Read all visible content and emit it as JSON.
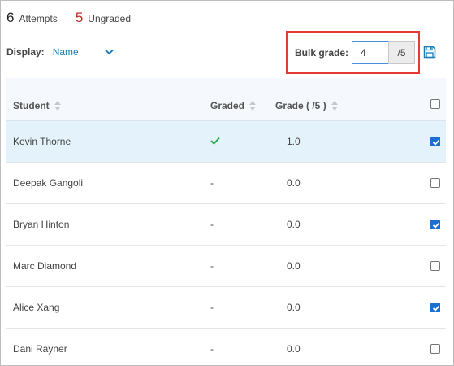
{
  "stats": {
    "attempts_count": "6",
    "attempts_label": "Attempts",
    "ungraded_count": "5",
    "ungraded_label": "Ungraded"
  },
  "display": {
    "label": "Display:",
    "selected": "Name"
  },
  "bulk": {
    "label": "Bulk grade:",
    "value": "4",
    "suffix": "/5"
  },
  "table": {
    "headers": {
      "student": "Student",
      "graded": "Graded",
      "grade": "Grade ( /5 )"
    },
    "rows": [
      {
        "student": "Kevin Thorne",
        "graded": "check",
        "grade": "1.0",
        "checked": true,
        "selected": true
      },
      {
        "student": "Deepak Gangoli",
        "graded": "-",
        "grade": "0.0",
        "checked": false,
        "selected": false
      },
      {
        "student": "Bryan Hinton",
        "graded": "-",
        "grade": "0.0",
        "checked": true,
        "selected": false
      },
      {
        "student": "Marc Diamond",
        "graded": "-",
        "grade": "0.0",
        "checked": false,
        "selected": false
      },
      {
        "student": "Alice Xang",
        "graded": "-",
        "grade": "0.0",
        "checked": true,
        "selected": false
      },
      {
        "student": "Dani Rayner",
        "graded": "-",
        "grade": "0.0",
        "checked": false,
        "selected": false
      }
    ]
  },
  "colors": {
    "accent_blue": "#1a7fb5",
    "checkbox_blue": "#1a6fd1",
    "graded_green": "#2eaa4f",
    "ungraded_red": "#c62828",
    "highlight_red": "#e53935",
    "selected_row": "#e4f3fb"
  },
  "icons": {
    "display_dropdown": "chevron-down-icon",
    "save": "save-icon",
    "sort": "sort-icon",
    "graded_check": "check-icon"
  }
}
